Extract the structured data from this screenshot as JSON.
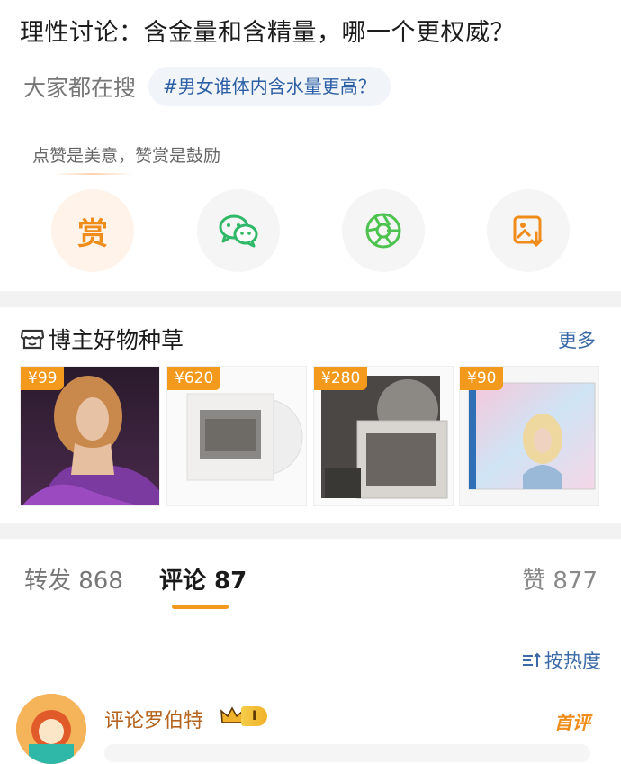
{
  "post": {
    "title": "理性讨论：含金量和含精量，哪一个更权威？"
  },
  "search": {
    "label": "大家都在搜",
    "hashtag": "#男女谁体内含水量更高？"
  },
  "reward": {
    "tip": "点赞是美意，赞赏是鼓励",
    "reward_glyph": "赏",
    "actions": [
      {
        "icon": "reward-icon"
      },
      {
        "icon": "wechat-icon"
      },
      {
        "icon": "moments-icon"
      },
      {
        "icon": "save-image-icon"
      }
    ]
  },
  "shop": {
    "title": "博主好物种草",
    "more": "更多",
    "products": [
      {
        "price": "¥99"
      },
      {
        "price": "¥620"
      },
      {
        "price": "¥280"
      },
      {
        "price": "¥90"
      }
    ]
  },
  "tabs": {
    "repost": "转发 868",
    "comment": "评论 87",
    "like": "赞 877"
  },
  "sort": {
    "label": "按热度"
  },
  "comment": {
    "author": "评论罗伯特",
    "level": "I",
    "badge": "首评"
  },
  "colors": {
    "accent": "#f39a1c",
    "link": "#3a6aa8",
    "wechat": "#2fb868",
    "moments": "#4fc34f"
  }
}
